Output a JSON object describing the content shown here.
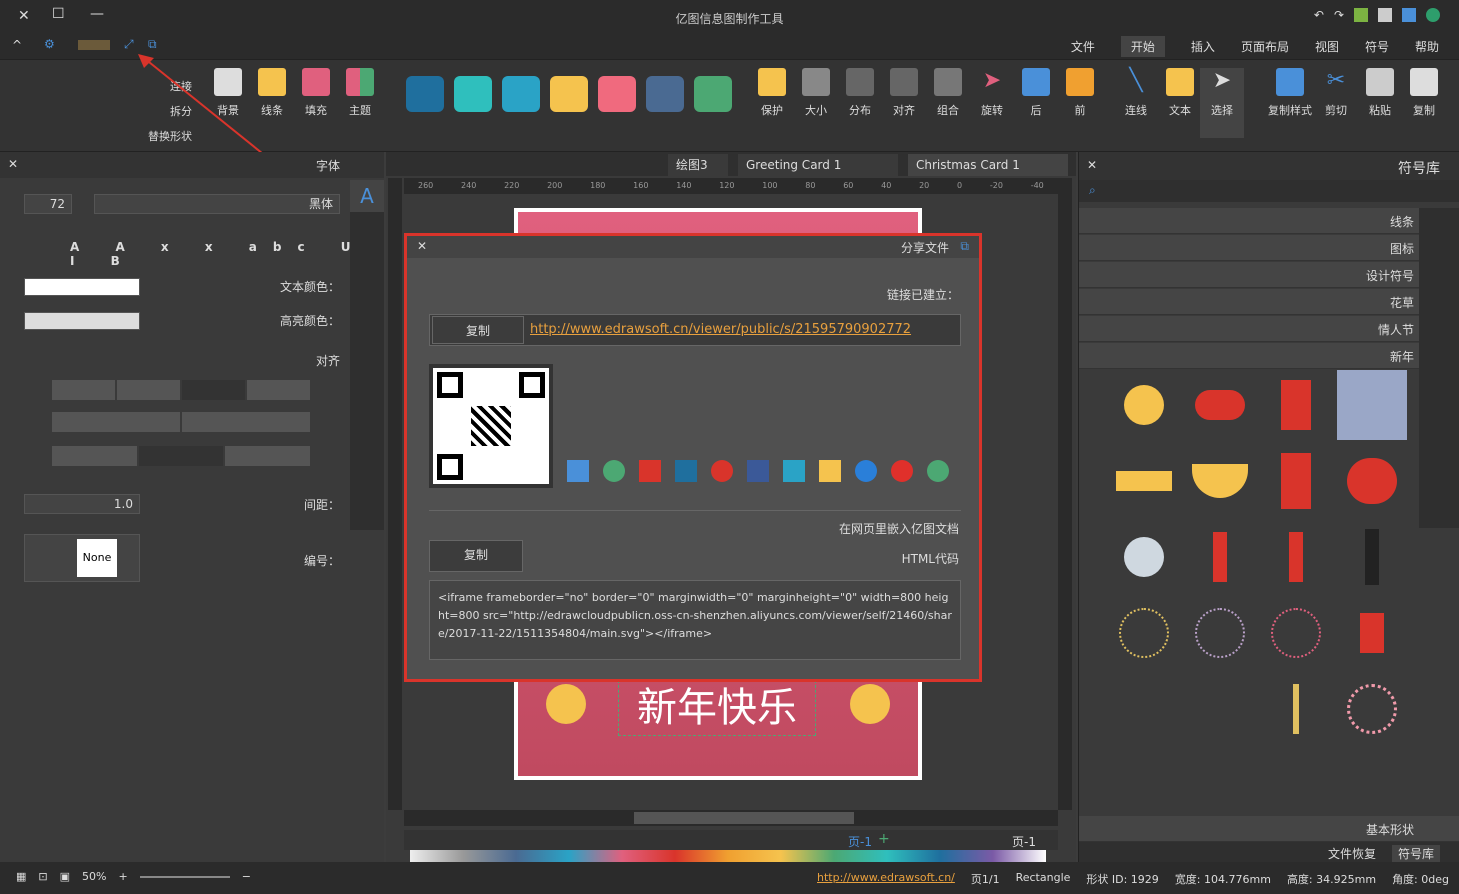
{
  "app": {
    "title": "亿图信息图制作工具"
  },
  "menu": {
    "tabs": [
      "文件",
      "开始",
      "插入",
      "页面布局",
      "视图",
      "符号",
      "帮助"
    ],
    "active": "开始"
  },
  "ribbon": {
    "left_buttons": [
      "复制",
      "粘贴",
      "剪切",
      "复制样式"
    ],
    "tools": [
      "选择",
      "文本",
      "连线"
    ],
    "arrange": [
      "前",
      "后",
      "旋转",
      "组合",
      "对齐",
      "分布",
      "大小",
      "保护"
    ],
    "styles": [
      "主题",
      "填充",
      "线条",
      "背景"
    ],
    "replace": [
      "连接",
      "拆分",
      "替换形状"
    ],
    "swatches": [
      "#1f6f9e",
      "#2fbfbd",
      "#2aa3c6",
      "#f5c34e",
      "#f06a7e",
      "#4a6a92",
      "#4ca873"
    ]
  },
  "library": {
    "title": "符号库",
    "categories": [
      "线条",
      "图标",
      "设计符号",
      "花草",
      "情人节",
      "新年"
    ],
    "bottom_category": "基本形状",
    "tabs": [
      "符号库",
      "文件恢复"
    ]
  },
  "doc_tabs": [
    "Christmas Card 1",
    "Greeting Card 1",
    "绘图3"
  ],
  "ruler": [
    "-40",
    "-20",
    "0",
    "20",
    "40",
    "60",
    "80",
    "100",
    "120",
    "140",
    "160",
    "180",
    "200",
    "220",
    "240",
    "260"
  ],
  "card_text": "新年快乐",
  "dialog": {
    "title": "分享文件",
    "link_label": "链接已建立：",
    "url": "http://www.edrawsoft.cn/viewer/public/s/21595790902772",
    "copy": "复制",
    "embed_label": "在网页里嵌入亿图文档",
    "html_label": "HTML代码",
    "html_code": "<iframe frameborder=\"no\" border=\"0\" marginwidth=\"0\" marginheight=\"0\" width=800 height=800 src=\"http://edrawcloudpublicn.oss-cn-shenzhen.aliyuncs.com/viewer/self/21460/share/2017-11-22/1511354804/main.svg\"></iframe>"
  },
  "textpanel": {
    "title": "字体",
    "font": "黑体",
    "size": "72",
    "text_color": "文本颜色：",
    "highlight": "高亮颜色：",
    "align": "对齐",
    "spacing": "间距：",
    "spacing_val": "1.0",
    "bullet": "编号：",
    "bullet_val": "None"
  },
  "pages": {
    "page": "页-1",
    "current": "页-1"
  },
  "status": {
    "url": "http://www.edrawsoft.cn/",
    "page": "页1/1",
    "shape": "形状 ID: 1929",
    "type": "Rectangle",
    "width": "宽度: 104.776mm",
    "height": "高度: 34.925mm",
    "angle": "角度: 0deg",
    "zoom": "50%"
  }
}
